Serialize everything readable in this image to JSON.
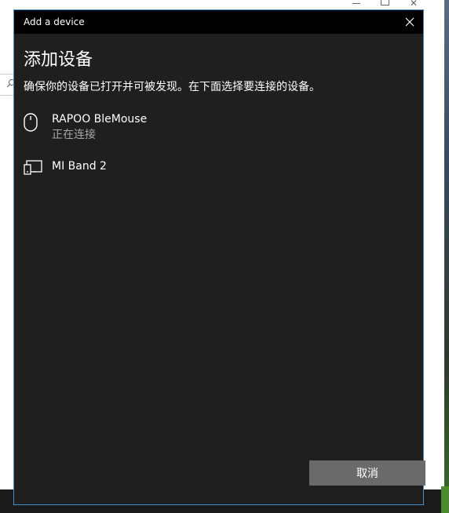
{
  "dialog": {
    "window_title": "Add a device",
    "heading": "添加设备",
    "subtitle": "确保你的设备已打开并可被发现。在下面选择要连接的设备。",
    "devices": [
      {
        "name": "RAPOO BleMouse",
        "status": "正在连接",
        "icon": "mouse-icon"
      },
      {
        "name": "MI Band 2",
        "status": "",
        "icon": "device-icon"
      }
    ],
    "cancel_label": "取消",
    "close_icon": "close-icon"
  },
  "colors": {
    "dialog_bg": "#1f1f1f",
    "titlebar_bg": "#000000",
    "accent_border": "#4a90c8",
    "button_bg": "#6a6a6a",
    "status_text": "#a6a6a6"
  }
}
